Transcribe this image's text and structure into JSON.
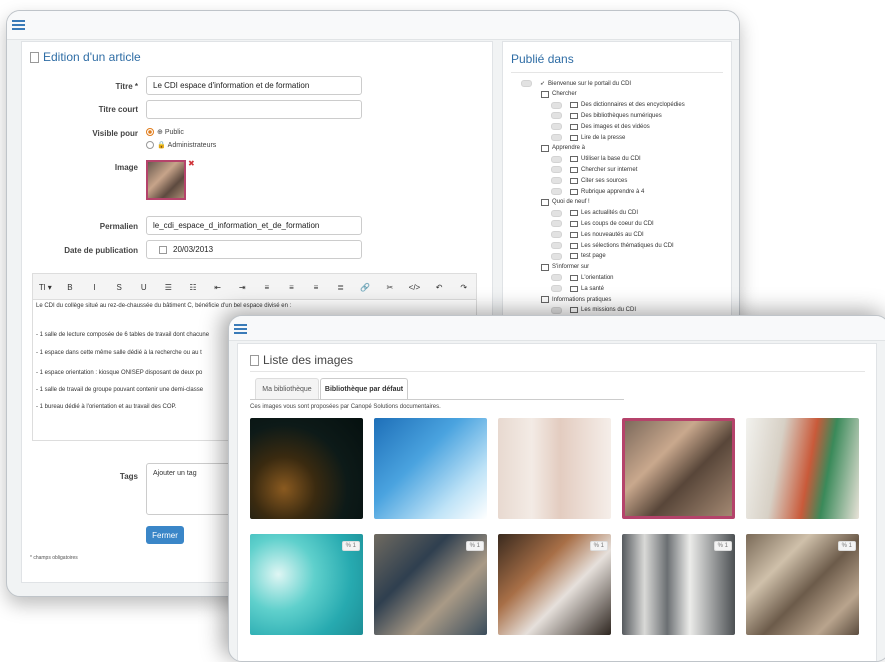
{
  "article": {
    "title": "Edition d'un article",
    "labels": {
      "titre": "Titre *",
      "titre_court": "Titre court",
      "visible": "Visible pour",
      "image": "Image",
      "permalien": "Permalien",
      "date": "Date de publication",
      "tags": "Tags"
    },
    "titre_value": "Le  CDI espace d'information et de formation",
    "titre_court_value": "",
    "visible_options": [
      "Public",
      "Administrateurs"
    ],
    "visible_selected": "Public",
    "permalien_value": "le_cdi_espace_d_information_et_de_formation",
    "date_value": "20/03/2013",
    "toolbar": [
      "Tl ▾",
      "B",
      "I",
      "S",
      "U",
      "☰",
      "☷",
      "⇤",
      "⇥",
      "≡",
      "≡",
      "≡",
      "≣",
      "🔗",
      "✂",
      "</>",
      "↶",
      "↷"
    ],
    "editor_lines": [
      "Le CDI du collège  situé au rez-de-chaussée du bâtiment C, bénéficie d'un bel espace divisé en :",
      "- 1 salle de lecture composée de 6 tables de travail dont chacune",
      "- 1 espace dans cette même salle dédié à la recherche ou au t",
      "- 1 espace orientation : kiosque ONISEP disposant de deux po",
      "- 1 salle de travail de groupe pouvant contenir une demi-classe",
      "- 1 bureau dédié à l'orientation et au travail des COP."
    ],
    "tags_placeholder": "Ajouter un tag",
    "close_button": "Fermer",
    "required_note": "* champs obligatoires"
  },
  "publie": {
    "title": "Publié dans",
    "tree": [
      {
        "label": "Bienvenue sur le portail du CDI",
        "level": 0,
        "kind": "root"
      },
      {
        "label": "Chercher",
        "level": 1,
        "kind": "folder"
      },
      {
        "label": "Des dictionnaires et des encyclopédies",
        "level": 2,
        "kind": "page"
      },
      {
        "label": "Des bibliothèques numériques",
        "level": 2,
        "kind": "page"
      },
      {
        "label": "Des images et des vidéos",
        "level": 2,
        "kind": "page"
      },
      {
        "label": "Lire de la presse",
        "level": 2,
        "kind": "page"
      },
      {
        "label": "Apprendre à",
        "level": 1,
        "kind": "folder"
      },
      {
        "label": "Utiliser la base du CDI",
        "level": 2,
        "kind": "page"
      },
      {
        "label": "Chercher sur internet",
        "level": 2,
        "kind": "page"
      },
      {
        "label": "Citer ses sources",
        "level": 2,
        "kind": "page"
      },
      {
        "label": "Rubrique apprendre à 4",
        "level": 2,
        "kind": "page"
      },
      {
        "label": "Quoi de neuf !",
        "level": 1,
        "kind": "folder"
      },
      {
        "label": "Les actualités du CDI",
        "level": 2,
        "kind": "page"
      },
      {
        "label": "Les coups de coeur du CDI",
        "level": 2,
        "kind": "page"
      },
      {
        "label": "Les nouveautés au CDI",
        "level": 2,
        "kind": "page"
      },
      {
        "label": "Les sélections thématiques du CDI",
        "level": 2,
        "kind": "page"
      },
      {
        "label": "test page",
        "level": 2,
        "kind": "page"
      },
      {
        "label": "S'informer sur",
        "level": 1,
        "kind": "folder"
      },
      {
        "label": "L'orientation",
        "level": 2,
        "kind": "page"
      },
      {
        "label": "La santé",
        "level": 2,
        "kind": "page"
      },
      {
        "label": "Informations pratiques",
        "level": 1,
        "kind": "folder"
      },
      {
        "label": "Les missions du CDI",
        "level": 2,
        "kind": "page"
      }
    ]
  },
  "images": {
    "title": "Liste des images",
    "tabs": [
      "Ma bibliothèque",
      "Bibliothèque par défaut"
    ],
    "active_tab": "Bibliothèque par défaut",
    "description": "Ces images vous sont proposées par Canopé Solutions documentaires.",
    "items": [
      {
        "kind": "abstract-dark",
        "count": "",
        "selected": false
      },
      {
        "kind": "abstract-blue",
        "count": "",
        "selected": false
      },
      {
        "kind": "bookshelf",
        "count": "",
        "selected": false
      },
      {
        "kind": "students-reading",
        "count": "",
        "selected": true
      },
      {
        "kind": "book-pages",
        "count": "",
        "selected": false
      },
      {
        "kind": "abstract-teal",
        "count": "1",
        "selected": false
      },
      {
        "kind": "students-library",
        "count": "1",
        "selected": false
      },
      {
        "kind": "girl-tablet",
        "count": "1",
        "selected": false
      },
      {
        "kind": "library-shelves",
        "count": "1",
        "selected": false
      },
      {
        "kind": "group-floor",
        "count": "1",
        "selected": false
      }
    ],
    "accent": "#b5436b"
  }
}
